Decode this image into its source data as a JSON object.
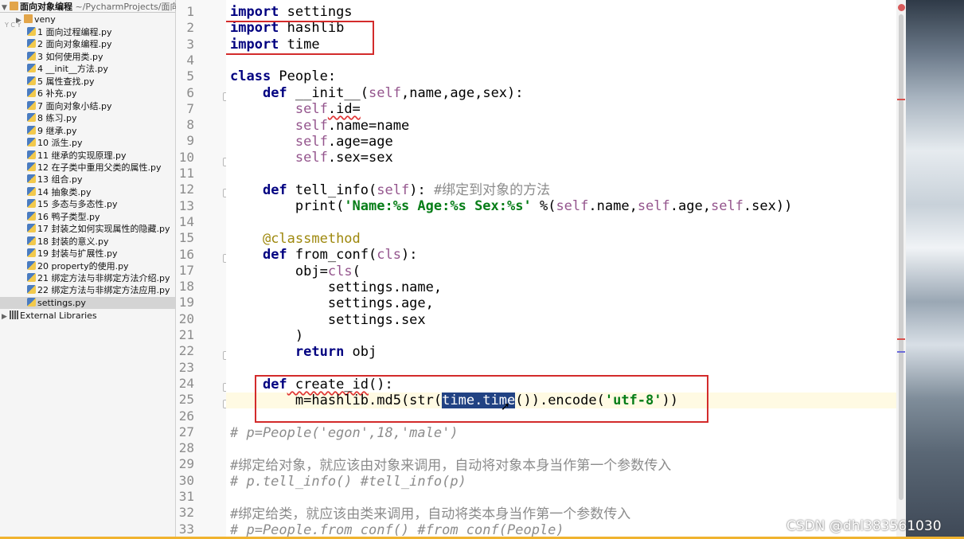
{
  "project": {
    "name": "面向对象编程",
    "path": "~/PycharmProjects/面向",
    "folder": "veny",
    "files": [
      "1 面向过程编程.py",
      "2 面向对象编程.py",
      "3 如何使用类.py",
      "4 __init__方法.py",
      "5 属性查找.py",
      "6 补充.py",
      "7 面向对象小结.py",
      "8 练习.py",
      "9 继承.py",
      "10 派生.py",
      "11 继承的实现原理.py",
      "12 在子类中重用父类的属性.py",
      "13 组合.py",
      "14 抽象类.py",
      "15 多态与多态性.py",
      "16 鸭子类型.py",
      "17 封装之如何实现属性的隐藏.py",
      "18 封装的意义.py",
      "19 封装与扩展性.py",
      "20 property的使用.py",
      "21 绑定方法与非绑定方法介绍.py",
      "22 绑定方法与非绑定方法应用.py",
      "settings.py"
    ],
    "selected_file": "settings.py",
    "external": "External Libraries",
    "strip_letters": "Y C Y"
  },
  "gutter": {
    "line_numbers": [
      "1",
      "2",
      "3",
      "4",
      "5",
      "6",
      "7",
      "8",
      "9",
      "10",
      "11",
      "12",
      "13",
      "14",
      "15",
      "16",
      "17",
      "18",
      "19",
      "20",
      "21",
      "22",
      "23",
      "24",
      "25",
      "26",
      "27",
      "28",
      "29",
      "30",
      "31",
      "32",
      "33"
    ]
  },
  "code": {
    "l1_kw": "import",
    "l1_rest": " settings",
    "l2_kw": "import",
    "l2_rest": " hashlib",
    "l3_kw": "import",
    "l3_rest": " time",
    "l5_kw": "class",
    "l5_rest": " People:",
    "l6_kw": "def",
    "l6_fn": " __init__(",
    "l6_self": "self",
    "l6_rest": ",name,age,sex):",
    "l7_self": "self",
    "l7_rest": ".id=",
    "l8_self": "self",
    "l8_rest": ".name=name",
    "l9_self": "self",
    "l9_rest": ".age=age",
    "l10_self": "self",
    "l10_rest": ".sex=sex",
    "l12_kw": "def",
    "l12_fn": " tell_info(",
    "l12_self": "self",
    "l12_mid": "): ",
    "l12_cm": "#绑定到对象的方法",
    "l13_fn": "print(",
    "l13_str": "'Name:%s Age:%s Sex:%s'",
    "l13_mid": " %(",
    "l13_s1": "self",
    "l13_a": ".name,",
    "l13_s2": "self",
    "l13_b": ".age,",
    "l13_s3": "self",
    "l13_c": ".sex))",
    "l15_dec": "@classmethod",
    "l16_kw": "def",
    "l16_fn": " from_conf(",
    "l16_cls": "cls",
    "l16_rest": "):",
    "l17_a": "obj=",
    "l17_cls": "cls",
    "l17_b": "(",
    "l18": "settings.name,",
    "l19": "settings.age,",
    "l20": "settings.sex",
    "l21": ")",
    "l22_kw": "return",
    "l22_rest": " obj",
    "l24_kw": "def",
    "l24_fn": " create_id",
    "l24_rest": "():",
    "l25_a": "m=hashlib.md5(str(",
    "l25_sel": "time.time",
    "l25_b": "()).encode(",
    "l25_str": "'utf-8'",
    "l25_c": "))",
    "l27": "# p=People('egon',18,'male')",
    "l29": "#绑定给对象，就应该由对象来调用，自动将对象本身当作第一个参数传入",
    "l30": "# p.tell_info() #tell_info(p)",
    "l32": "#绑定给类，就应该由类来调用，自动将类本身当作第一个参数传入",
    "l33": "# p=People.from_conf() #from_conf(People)"
  },
  "watermark": "CSDN @dhl383561030",
  "colors": {
    "highlight_box": "#d32b2b",
    "keyword": "#000080",
    "self": "#94558d",
    "string": "#067d17",
    "selection": "#214283"
  }
}
